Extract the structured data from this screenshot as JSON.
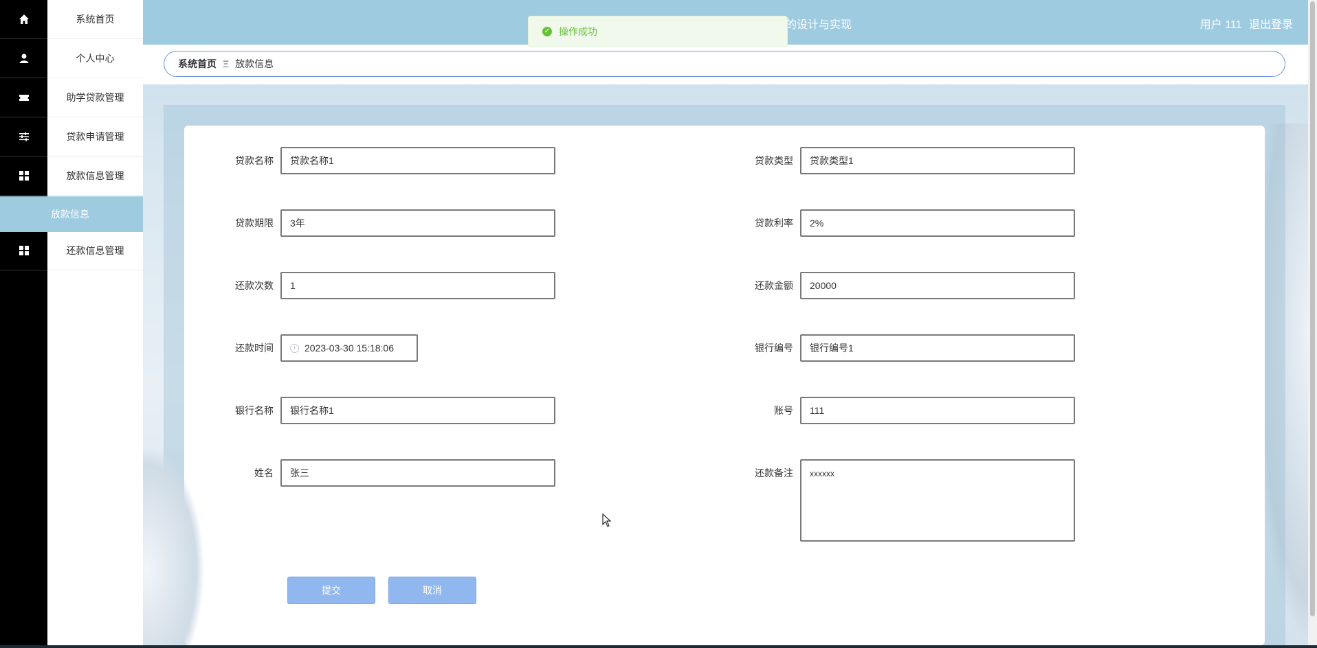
{
  "header": {
    "title": "的设计与实现",
    "user_label": "用户 111",
    "logout_label": "退出登录"
  },
  "toast": {
    "message": "操作成功"
  },
  "breadcrumb": {
    "home": "系统首页",
    "separator": "Ξ",
    "current": "放款信息"
  },
  "sidebar": {
    "items": [
      {
        "label": "系统首页",
        "icon": "home-icon"
      },
      {
        "label": "个人中心",
        "icon": "user-icon"
      },
      {
        "label": "助学贷款管理",
        "icon": "ticket-icon"
      },
      {
        "label": "贷款申请管理",
        "icon": "sliders-icon"
      },
      {
        "label": "放款信息管理",
        "icon": "grid-icon"
      },
      {
        "label": "还款信息管理",
        "icon": "grid-icon"
      }
    ],
    "active_sub": "放款信息"
  },
  "form": {
    "loan_name": {
      "label": "贷款名称",
      "value": "贷款名称1"
    },
    "loan_type": {
      "label": "贷款类型",
      "value": "贷款类型1"
    },
    "loan_term": {
      "label": "贷款期限",
      "value": "3年"
    },
    "loan_rate": {
      "label": "贷款利率",
      "value": "2%"
    },
    "repay_times": {
      "label": "还款次数",
      "value": "1"
    },
    "repay_amount": {
      "label": "还款金额",
      "value": "20000"
    },
    "repay_time": {
      "label": "还款时间",
      "value": "2023-03-30 15:18:06"
    },
    "bank_no": {
      "label": "银行编号",
      "value": "银行编号1"
    },
    "bank_name": {
      "label": "银行名称",
      "value": "银行名称1"
    },
    "account": {
      "label": "账号",
      "value": "111"
    },
    "name": {
      "label": "姓名",
      "value": "张三"
    },
    "repay_note": {
      "label": "还款备注",
      "value": "xxxxxx"
    },
    "submit_label": "提交",
    "cancel_label": "取消"
  }
}
